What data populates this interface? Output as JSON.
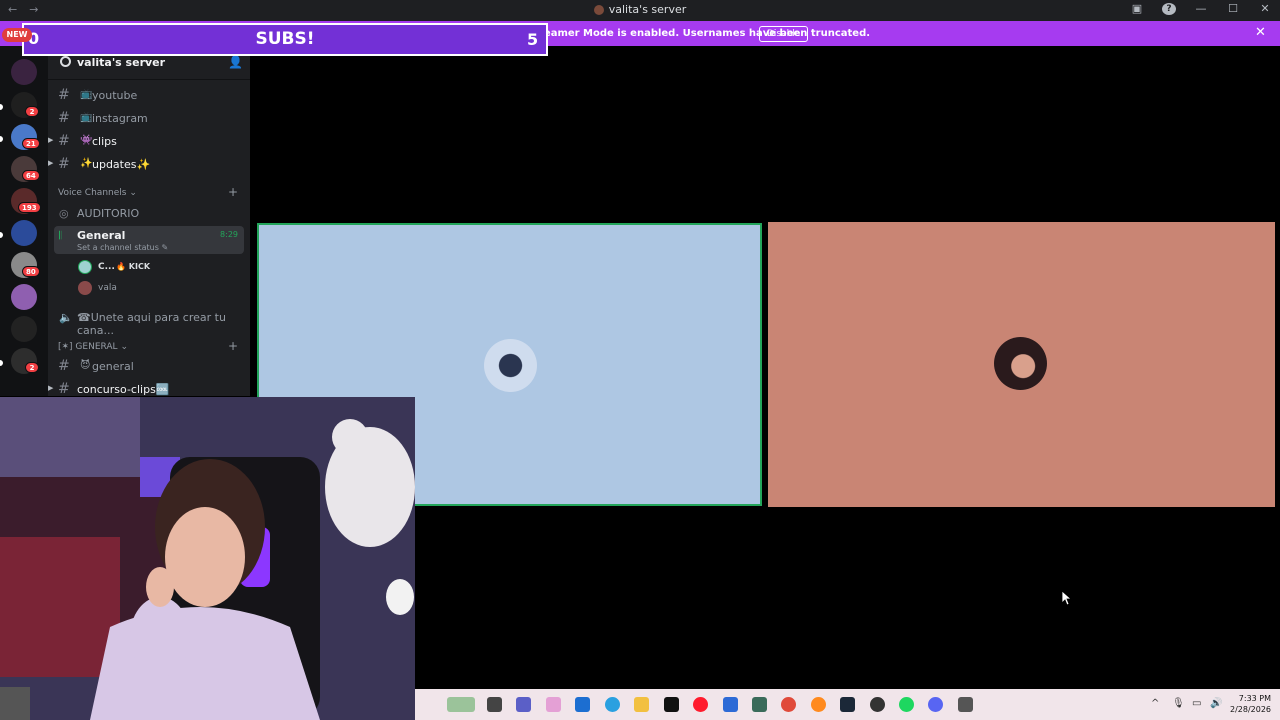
{
  "window": {
    "title": "valita's server",
    "back": "←",
    "forward": "→",
    "help": "?",
    "minimize": "—",
    "maximize": "☐",
    "close": "✕"
  },
  "banner": {
    "text": "Streamer Mode is enabled. Usernames have been truncated.",
    "disable_label": "Disable",
    "close": "✕"
  },
  "subs_overlay": {
    "title": "SUBS!",
    "left_value": "0",
    "right_value": "5",
    "new_badge": "NEW"
  },
  "rail_badges": [
    "2",
    "21",
    "64",
    "193",
    "80",
    "2"
  ],
  "sidebar": {
    "server_name": "valita's server",
    "caret": "⌄",
    "channels_top": [
      {
        "emoji": "📺",
        "label": "youtube"
      },
      {
        "emoji": "📺",
        "label": "instagram"
      },
      {
        "emoji": "👾",
        "label": "clips"
      },
      {
        "emoji": "✨",
        "label": "updates✨"
      }
    ],
    "voice_category": "Voice Channels",
    "voice_category_caret": "⌄",
    "voice_channels": {
      "auditorio": "AUDITORIO",
      "general": "General",
      "general_status": "Set a channel status",
      "general_time": "8:29",
      "create": "☎Unete aqui para crear tu cana..."
    },
    "voice_users": [
      {
        "name": "C...",
        "tag": "KICK"
      },
      {
        "name": "vala",
        "tag": ""
      }
    ],
    "general_category": "[✶] GENERAL",
    "general_channels": [
      {
        "emoji": "😈",
        "label": "general"
      },
      {
        "emoji": "",
        "label": "concurso-clips🆒"
      }
    ],
    "plus": "+"
  },
  "taskbar": {
    "time": "7:33 PM",
    "date": "2/28/2026",
    "tray_caret": "^"
  },
  "colors": {
    "banner": "#a63bf0",
    "tile_left": "#aec7e3",
    "tile_right": "#c98574",
    "speaking": "#23a55a"
  }
}
